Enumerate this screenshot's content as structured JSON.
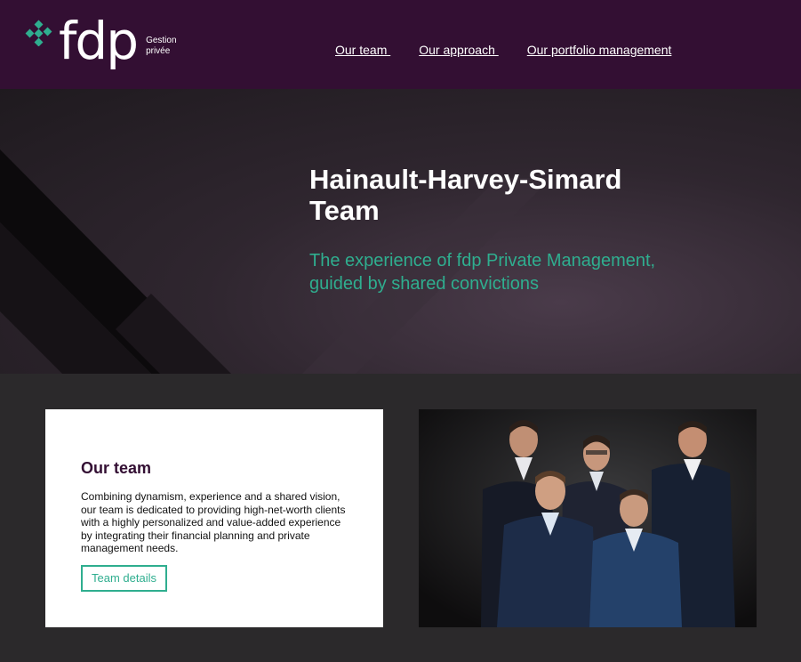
{
  "header": {
    "logo_text": "fdp",
    "logo_sub_line1": "Gestion",
    "logo_sub_line2": "privée",
    "nav": [
      {
        "label": "Our team "
      },
      {
        "label": "Our approach "
      },
      {
        "label": "Our portfolio management"
      }
    ]
  },
  "hero": {
    "title": "Hainault-Harvey-Simard Team",
    "subtitle": "The experience of fdp Private Management, guided by shared convictions"
  },
  "team_card": {
    "title": "Our team",
    "description": "Combining dynamism, experience and a shared vision, our team is dedicated to providing high-net-worth clients with a highly personalized and value-added experience by integrating their financial planning and private management needs.",
    "button_label": "Team details"
  },
  "colors": {
    "header_bg": "#330f33",
    "accent": "#2fae8f",
    "section_bg": "#2b292b"
  }
}
